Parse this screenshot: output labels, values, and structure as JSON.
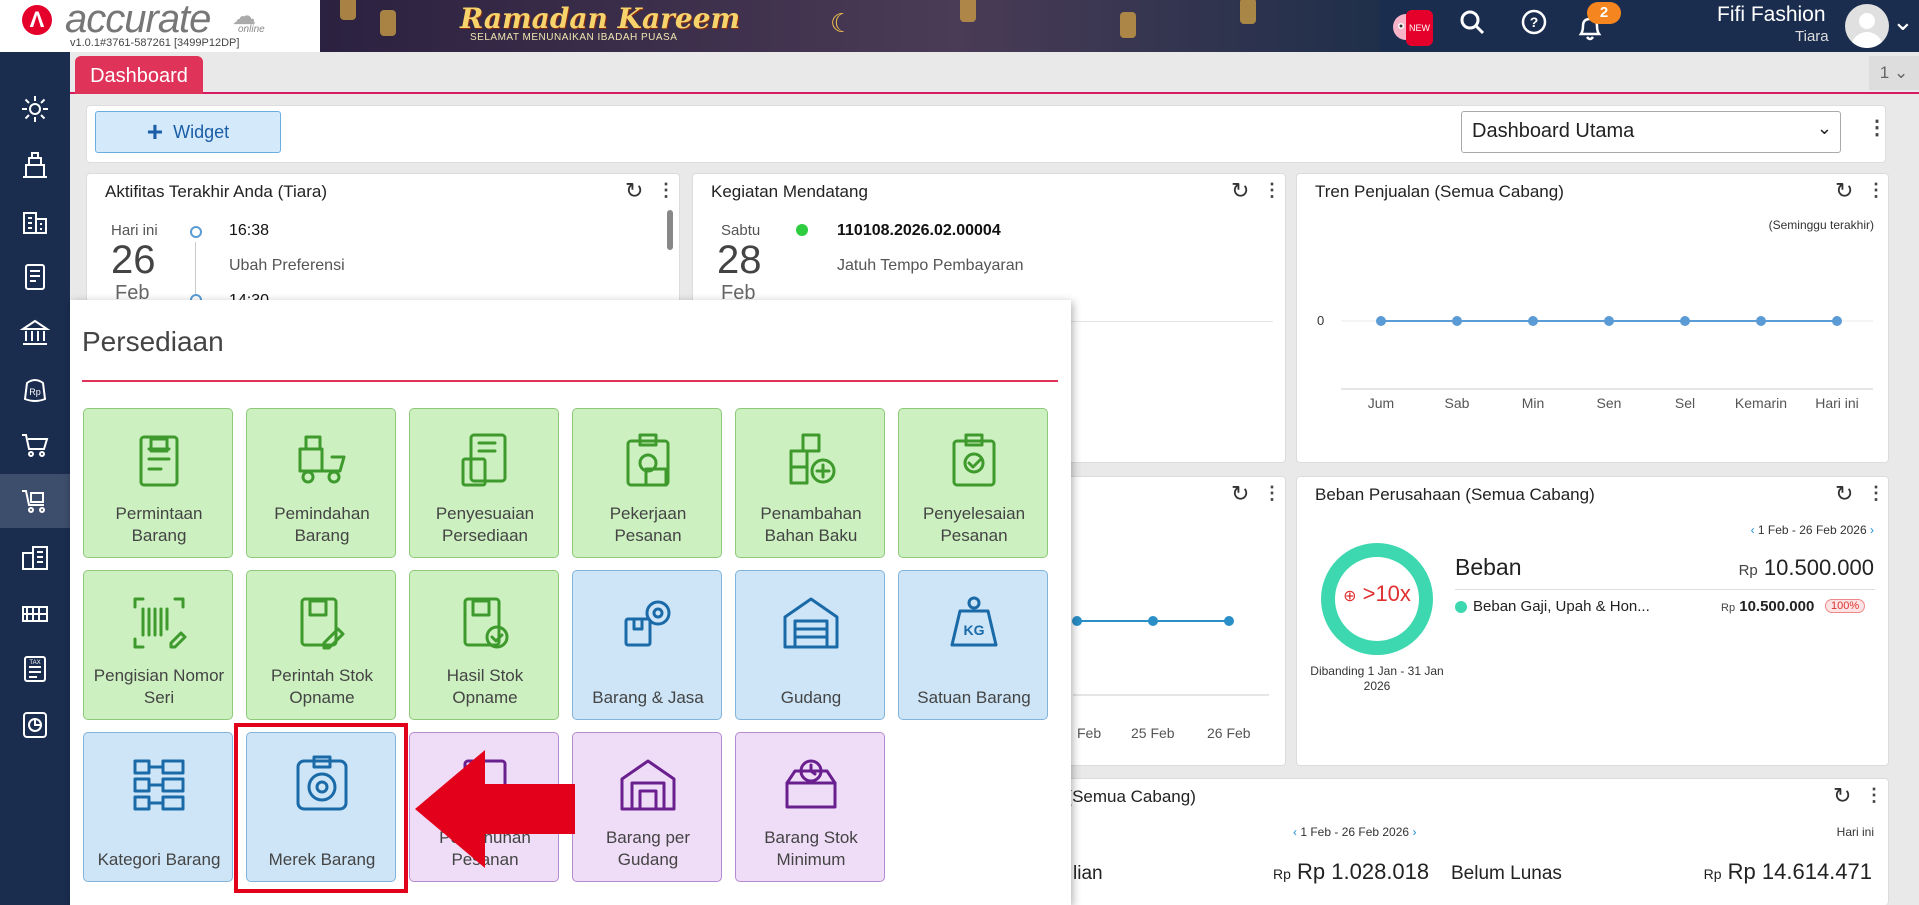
{
  "app": {
    "logo_text": "accurate",
    "logo_suffix": "online",
    "version": "v1.0.1#3761-587261 [3499P12DP]"
  },
  "banner": {
    "title": "Ramadan Kareem",
    "subtitle": "SELAMAT MENUNAIKAN IBADAH PUASA"
  },
  "topbar": {
    "new_badge": "NEW",
    "notification_count": "2",
    "user_name": "Fifi Fashion",
    "user_role": "Tiara"
  },
  "tabs": {
    "active_tab": "Dashboard",
    "tab_count": "1"
  },
  "toolbar": {
    "widget_label": "Widget",
    "dashboard_select": "Dashboard Utama"
  },
  "panels": {
    "aktifitas": {
      "title": "Aktifitas Terakhir Anda (Tiara)",
      "day_label": "Hari ini",
      "day_num": "26",
      "month": "Feb",
      "time": "16:38",
      "desc": "Ubah Preferensi",
      "time2": "14:30"
    },
    "kegiatan": {
      "title": "Kegiatan Mendatang",
      "day_label": "Sabtu",
      "day_num": "28",
      "month": "Feb",
      "doc": "110108.2026.02.00004",
      "desc": "Jatuh Tempo Pembayaran"
    },
    "tren": {
      "title": "Tren Penjualan (Semua Cabang)",
      "period": "(Seminggu terakhir)",
      "zero": "0"
    },
    "middle_chart": {
      "labels": [
        "Feb",
        "25 Feb",
        "26 Feb"
      ]
    },
    "beban": {
      "title": "Beban Perusahaan (Semua Cabang)",
      "range": "1 Feb - 26 Feb 2026",
      "ring_text": ">10x",
      "compare": "Dibanding 1 Jan - 31 Jan 2026",
      "heading": "Beban",
      "rp": "Rp",
      "total": "10.500.000",
      "item_label": "Beban Gaji, Upah & Hon...",
      "item_value": "10.500.000",
      "item_pct": "100%"
    },
    "bottom": {
      "title": "ian (Semua Cabang)",
      "range": "1 Feb - 26 Feb 2026",
      "right_label": "Hari ini",
      "left_label": "lian",
      "rp": "Rp",
      "left_value": "Rp 1.028.018",
      "belum_label": "Belum Lunas",
      "belum_value": "Rp 14.614.471"
    }
  },
  "chart_data": {
    "type": "line",
    "title": "Tren Penjualan (Semua Cabang)",
    "categories": [
      "Jum",
      "Sab",
      "Min",
      "Sen",
      "Sel",
      "Kemarin",
      "Hari ini"
    ],
    "values": [
      0,
      0,
      0,
      0,
      0,
      0,
      0
    ],
    "color": "#5b9bd5"
  },
  "persediaan": {
    "title": "Persediaan",
    "tiles": [
      {
        "label": "Permintaan Barang",
        "color": "green",
        "icon": "document-icon"
      },
      {
        "label": "Pemindahan Barang",
        "color": "green",
        "icon": "forklift-icon"
      },
      {
        "label": "Penyesuaian Persediaan",
        "color": "green",
        "icon": "box-document-icon"
      },
      {
        "label": "Pekerjaan Pesanan",
        "color": "green",
        "icon": "clipboard-gear-icon"
      },
      {
        "label": "Penambahan Bahan Baku",
        "color": "green",
        "icon": "boxes-plus-icon"
      },
      {
        "label": "Penyelesaian Pesanan",
        "color": "green",
        "icon": "clipboard-check-icon"
      },
      {
        "label": "Pengisian Nomor Seri",
        "color": "green",
        "icon": "barcode-icon"
      },
      {
        "label": "Perintah Stok Opname",
        "color": "green",
        "icon": "document-pen-icon"
      },
      {
        "label": "Hasil Stok Opname",
        "color": "green",
        "icon": "document-check-icon"
      },
      {
        "label": "Barang & Jasa",
        "color": "blue",
        "icon": "box-gear-icon"
      },
      {
        "label": "Gudang",
        "color": "blue",
        "icon": "warehouse-icon"
      },
      {
        "label": "Satuan Barang",
        "color": "blue",
        "icon": "weight-kg-icon"
      },
      {
        "label": "Kategori Barang",
        "color": "blue",
        "icon": "category-grid-icon"
      },
      {
        "label": "Merek Barang",
        "color": "blue",
        "icon": "brand-badge-icon"
      },
      {
        "label": "Pemenuhan Pesanan",
        "color": "purple",
        "icon": "order-box-icon"
      },
      {
        "label": "Barang per Gudang",
        "color": "purple",
        "icon": "warehouse-box-icon"
      },
      {
        "label": "Barang Stok Minimum",
        "color": "purple",
        "icon": "box-min-icon"
      }
    ],
    "colors": {
      "green": "#ccf0c0",
      "blue": "#cde5f7",
      "purple": "#efdcf7"
    }
  },
  "sidebar": {
    "items": [
      "settings-icon",
      "sales-icon",
      "company-icon",
      "ledger-icon",
      "bank-icon",
      "payment-icon",
      "purchase-icon",
      "inventory-icon",
      "assets-icon",
      "production-icon",
      "tax-icon",
      "report-icon"
    ]
  },
  "accent": "#e0335a"
}
